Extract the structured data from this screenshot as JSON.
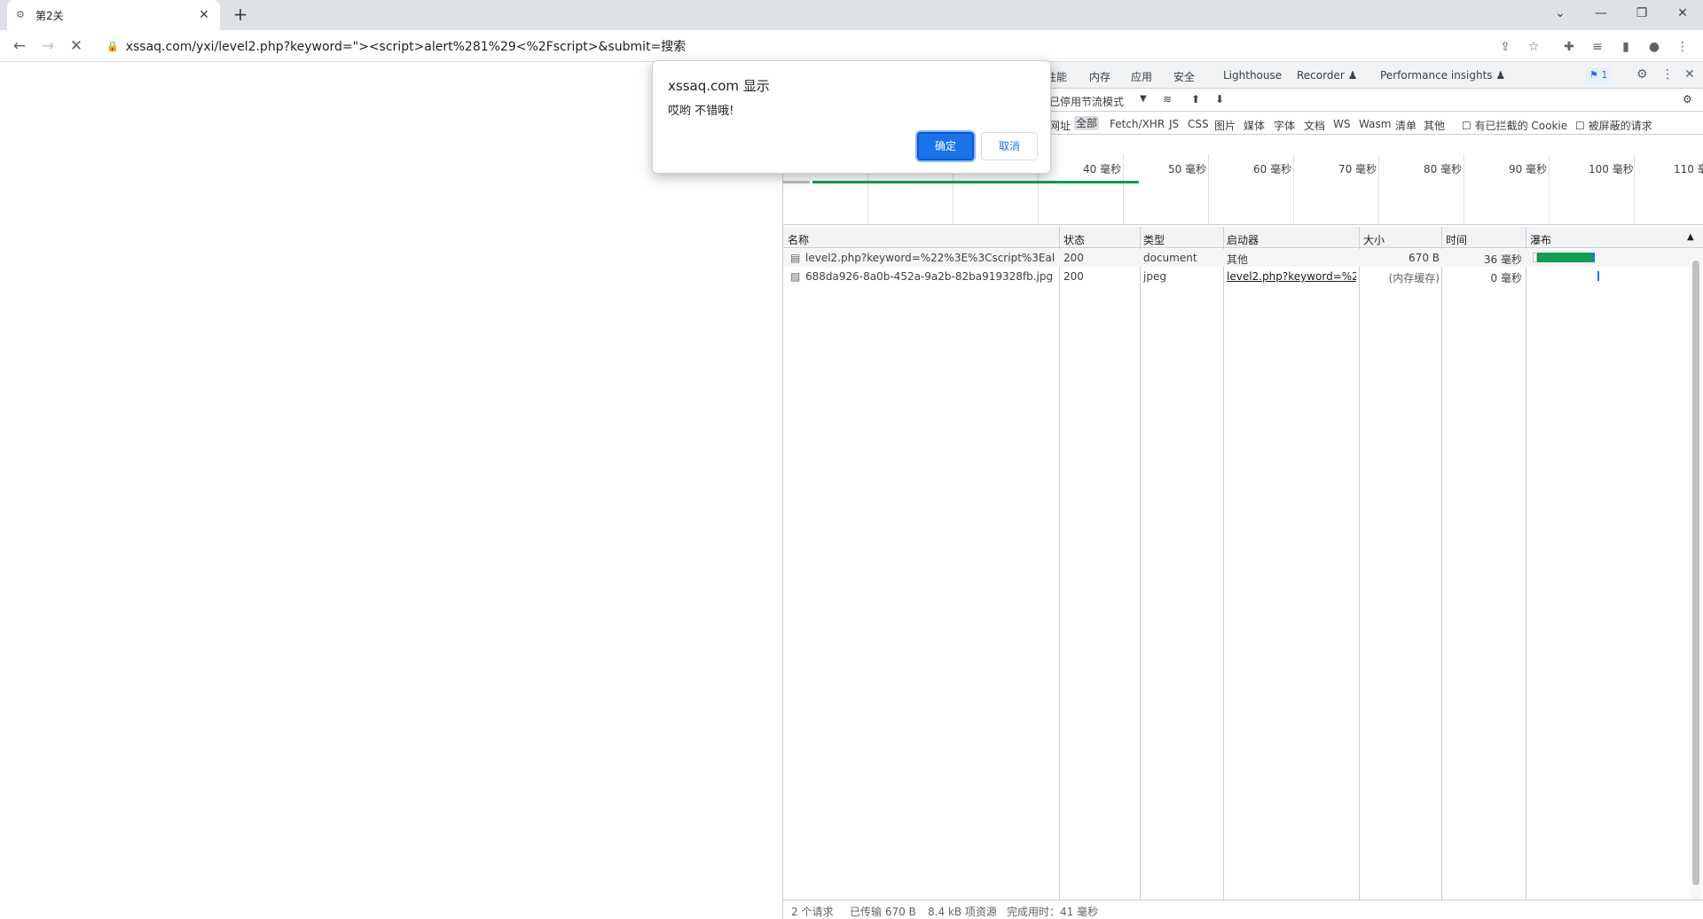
{
  "browser": {
    "tab": {
      "title": "第2关",
      "favicon": "gear-icon"
    },
    "new_tab": "+",
    "url": "xssaq.com/yxi/level2.php?keyword=\"><script>alert%281%29<%2Fscript>&submit=搜索"
  },
  "alert": {
    "title": "xssaq.com 显示",
    "message": "哎哟 不错哦!",
    "ok": "确定",
    "cancel": "取消"
  },
  "devtools": {
    "tabs": [
      "性能",
      "内存",
      "应用",
      "安全",
      "Lighthouse",
      "Recorder ♟",
      "Performance insights ♟"
    ],
    "issues_count": "1",
    "throttle": "已停用节流模式",
    "filters": [
      "网址",
      "全部",
      "Fetch/XHR",
      "JS",
      "CSS",
      "图片",
      "媒体",
      "字体",
      "文档",
      "WS",
      "Wasm",
      "清单",
      "其他"
    ],
    "active_filter": "全部",
    "checkboxes": [
      "有已拦截的 Cookie",
      "被屏蔽的请求"
    ],
    "timeline_ticks": [
      "40 毫秒",
      "50 毫秒",
      "60 毫秒",
      "70 毫秒",
      "80 毫秒",
      "90 毫秒",
      "100 毫秒",
      "110 毫"
    ],
    "columns": [
      "名称",
      "状态",
      "类型",
      "启动器",
      "大小",
      "时间",
      "瀑布"
    ],
    "rows": [
      {
        "name": "level2.php?keyword=%22%3E%3Cscript%3Ealert%...",
        "status": "200",
        "type": "document",
        "initiator": "其他",
        "size": "670 B",
        "time": "36 毫秒",
        "icon": "document-icon"
      },
      {
        "name": "688da926-8a0b-452a-9a2b-82ba919328fb.jpg",
        "status": "200",
        "type": "jpeg",
        "initiator": "level2.php?keyword=%22...",
        "size": "(内存缓存)",
        "time": "0 毫秒",
        "icon": "image-icon"
      }
    ],
    "status_bar": [
      "2 个请求",
      "已传输 670 B",
      "8.4 kB 项资源",
      "完成用时：41 毫秒"
    ],
    "colors": {
      "waterfall_green": "#0f9d58",
      "waterfall_blue": "#1a73e8"
    }
  }
}
